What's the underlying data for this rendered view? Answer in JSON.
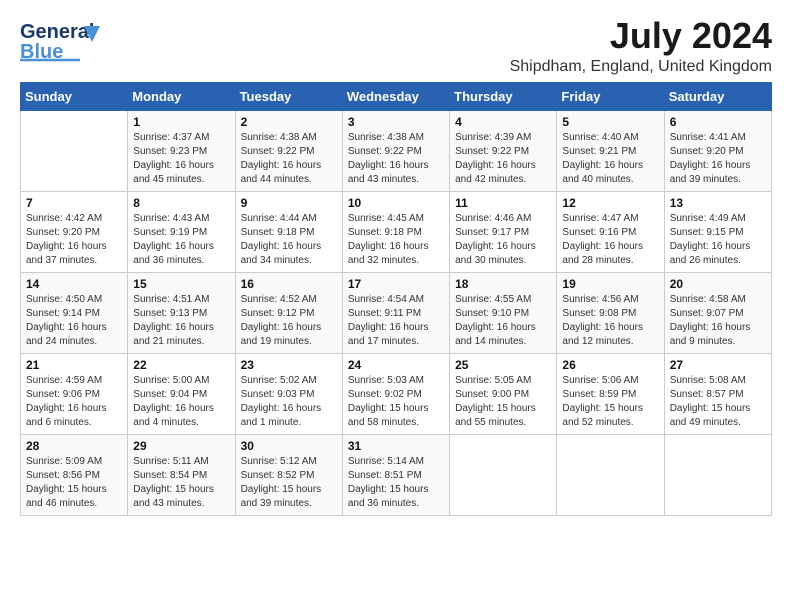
{
  "header": {
    "logo_general": "General",
    "logo_blue": "Blue",
    "month_title": "July 2024",
    "location": "Shipdham, England, United Kingdom"
  },
  "days_of_week": [
    "Sunday",
    "Monday",
    "Tuesday",
    "Wednesday",
    "Thursday",
    "Friday",
    "Saturday"
  ],
  "weeks": [
    [
      {
        "day": "",
        "info": ""
      },
      {
        "day": "1",
        "info": "Sunrise: 4:37 AM\nSunset: 9:23 PM\nDaylight: 16 hours and 45 minutes."
      },
      {
        "day": "2",
        "info": "Sunrise: 4:38 AM\nSunset: 9:22 PM\nDaylight: 16 hours and 44 minutes."
      },
      {
        "day": "3",
        "info": "Sunrise: 4:38 AM\nSunset: 9:22 PM\nDaylight: 16 hours and 43 minutes."
      },
      {
        "day": "4",
        "info": "Sunrise: 4:39 AM\nSunset: 9:22 PM\nDaylight: 16 hours and 42 minutes."
      },
      {
        "day": "5",
        "info": "Sunrise: 4:40 AM\nSunset: 9:21 PM\nDaylight: 16 hours and 40 minutes."
      },
      {
        "day": "6",
        "info": "Sunrise: 4:41 AM\nSunset: 9:20 PM\nDaylight: 16 hours and 39 minutes."
      }
    ],
    [
      {
        "day": "7",
        "info": "Sunrise: 4:42 AM\nSunset: 9:20 PM\nDaylight: 16 hours and 37 minutes."
      },
      {
        "day": "8",
        "info": "Sunrise: 4:43 AM\nSunset: 9:19 PM\nDaylight: 16 hours and 36 minutes."
      },
      {
        "day": "9",
        "info": "Sunrise: 4:44 AM\nSunset: 9:18 PM\nDaylight: 16 hours and 34 minutes."
      },
      {
        "day": "10",
        "info": "Sunrise: 4:45 AM\nSunset: 9:18 PM\nDaylight: 16 hours and 32 minutes."
      },
      {
        "day": "11",
        "info": "Sunrise: 4:46 AM\nSunset: 9:17 PM\nDaylight: 16 hours and 30 minutes."
      },
      {
        "day": "12",
        "info": "Sunrise: 4:47 AM\nSunset: 9:16 PM\nDaylight: 16 hours and 28 minutes."
      },
      {
        "day": "13",
        "info": "Sunrise: 4:49 AM\nSunset: 9:15 PM\nDaylight: 16 hours and 26 minutes."
      }
    ],
    [
      {
        "day": "14",
        "info": "Sunrise: 4:50 AM\nSunset: 9:14 PM\nDaylight: 16 hours and 24 minutes."
      },
      {
        "day": "15",
        "info": "Sunrise: 4:51 AM\nSunset: 9:13 PM\nDaylight: 16 hours and 21 minutes."
      },
      {
        "day": "16",
        "info": "Sunrise: 4:52 AM\nSunset: 9:12 PM\nDaylight: 16 hours and 19 minutes."
      },
      {
        "day": "17",
        "info": "Sunrise: 4:54 AM\nSunset: 9:11 PM\nDaylight: 16 hours and 17 minutes."
      },
      {
        "day": "18",
        "info": "Sunrise: 4:55 AM\nSunset: 9:10 PM\nDaylight: 16 hours and 14 minutes."
      },
      {
        "day": "19",
        "info": "Sunrise: 4:56 AM\nSunset: 9:08 PM\nDaylight: 16 hours and 12 minutes."
      },
      {
        "day": "20",
        "info": "Sunrise: 4:58 AM\nSunset: 9:07 PM\nDaylight: 16 hours and 9 minutes."
      }
    ],
    [
      {
        "day": "21",
        "info": "Sunrise: 4:59 AM\nSunset: 9:06 PM\nDaylight: 16 hours and 6 minutes."
      },
      {
        "day": "22",
        "info": "Sunrise: 5:00 AM\nSunset: 9:04 PM\nDaylight: 16 hours and 4 minutes."
      },
      {
        "day": "23",
        "info": "Sunrise: 5:02 AM\nSunset: 9:03 PM\nDaylight: 16 hours and 1 minute."
      },
      {
        "day": "24",
        "info": "Sunrise: 5:03 AM\nSunset: 9:02 PM\nDaylight: 15 hours and 58 minutes."
      },
      {
        "day": "25",
        "info": "Sunrise: 5:05 AM\nSunset: 9:00 PM\nDaylight: 15 hours and 55 minutes."
      },
      {
        "day": "26",
        "info": "Sunrise: 5:06 AM\nSunset: 8:59 PM\nDaylight: 15 hours and 52 minutes."
      },
      {
        "day": "27",
        "info": "Sunrise: 5:08 AM\nSunset: 8:57 PM\nDaylight: 15 hours and 49 minutes."
      }
    ],
    [
      {
        "day": "28",
        "info": "Sunrise: 5:09 AM\nSunset: 8:56 PM\nDaylight: 15 hours and 46 minutes."
      },
      {
        "day": "29",
        "info": "Sunrise: 5:11 AM\nSunset: 8:54 PM\nDaylight: 15 hours and 43 minutes."
      },
      {
        "day": "30",
        "info": "Sunrise: 5:12 AM\nSunset: 8:52 PM\nDaylight: 15 hours and 39 minutes."
      },
      {
        "day": "31",
        "info": "Sunrise: 5:14 AM\nSunset: 8:51 PM\nDaylight: 15 hours and 36 minutes."
      },
      {
        "day": "",
        "info": ""
      },
      {
        "day": "",
        "info": ""
      },
      {
        "day": "",
        "info": ""
      }
    ]
  ]
}
